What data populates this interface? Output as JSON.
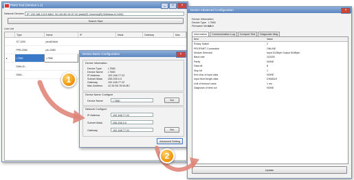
{
  "main_window": {
    "title": "PNIO Tool (Version 1.1)",
    "network_devices_label": "Network Devices",
    "network_device_value": "IP: 192.168.3.119 MAC: 5C-A9-5D-92-97-40 (Intel(R) Centrino(R) Wireless-N 1000)",
    "search_button": "Search Start",
    "live_list_label": "Live List",
    "columns": [
      "Type",
      "Name",
      "IP",
      "Mask",
      "Gateway",
      "Mac"
    ],
    "rows": [
      {
        "type": "S7-1200",
        "name": "plcs81fd4d",
        "ip": "",
        "mask": "",
        "gateway": "",
        "mac": ""
      },
      {
        "type": "PPB-2060",
        "name": "pfo-2060",
        "ip": "",
        "mask": "",
        "gateway": "",
        "mac": ""
      },
      {
        "type": "i-7580",
        "name": "i-7580",
        "ip": "",
        "mask": "",
        "gateway": "",
        "mac": ""
      },
      {
        "type": "DMA-I0...",
        "name": "",
        "ip": "",
        "mask": "",
        "gateway": "",
        "mac": ""
      },
      {
        "type": "DMA...",
        "name": "",
        "ip": "",
        "mask": "",
        "gateway": "",
        "mac": ""
      }
    ]
  },
  "basic_config": {
    "title": "Device Basic Configuration",
    "info_group": "Device Information",
    "info": [
      {
        "label": "Device Type",
        "value": "I-7580"
      },
      {
        "label": "Device Name",
        "value": "i-7580"
      },
      {
        "label": "IP Address",
        "value": "192.168.77.22"
      },
      {
        "label": "Subnet Mask",
        "value": "255.255.0.0"
      },
      {
        "label": "Gateway",
        "value": "192.168.77.22"
      },
      {
        "label": "Mac Address",
        "value": "12.34.56.78.9A.BC"
      }
    ],
    "name_group": "Device Name Configure",
    "name_label": "Device Name",
    "name_value": "i-7580",
    "set_label": "Set",
    "net_group": "Network Configure",
    "ip_label": "IP Address",
    "ip_value": "192.168.77.22",
    "mask_label": "Subnet Mask",
    "mask_value": "255.255.0.0",
    "gw_label": "Gateway",
    "gw_value": "192.168.77.22",
    "advanced_button": "Advanced Setting"
  },
  "advanced_config": {
    "title": "Device Advanced Configuration",
    "info_header": "Device Information",
    "device_type_label": "Device Type",
    "device_type_value": "I-7580",
    "firmware_label": "Firmware Version",
    "firmware_value": "V1.0",
    "tabs": [
      "Information",
      "Communication Log",
      "Comport Test",
      "Diagnostic Msg"
    ],
    "columns": [
      "Item",
      "Value"
    ],
    "rows": [
      {
        "item": "Rotary Switch",
        "value": "2"
      },
      {
        "item": "PROFINET Connection",
        "value": "ONLINE"
      },
      {
        "item": "Module Selected",
        "value": "Input 512Byte Output 504Byte"
      },
      {
        "item": "Baud rate",
        "value": "115200"
      },
      {
        "item": "Parity",
        "value": "NONE"
      },
      {
        "item": "Data bit",
        "value": "8"
      },
      {
        "item": "Stop bit",
        "value": "1"
      },
      {
        "item": "End char of input data",
        "value": "NONE"
      },
      {
        "item": "Input fixed length data",
        "value": "DISABLE"
      },
      {
        "item": "Unit of timeout value",
        "value": "1 ms"
      },
      {
        "item": "Diagnosis of time out",
        "value": "NONE"
      }
    ],
    "update_button": "Update"
  },
  "badges": {
    "step1": "1",
    "step2": "2"
  },
  "colors": {
    "titlebar": "#6a91c6",
    "arrow": "#e0867a",
    "badge": "#f29b12",
    "selection": "#3a78c8"
  }
}
